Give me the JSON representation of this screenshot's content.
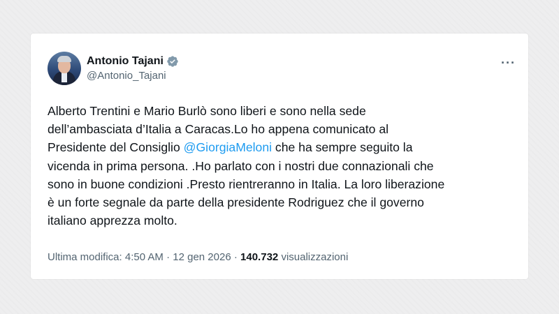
{
  "colors": {
    "background": "#eeeeef",
    "card": "#ffffff",
    "text": "#0f1419",
    "muted": "#536471",
    "link": "#1d9bf0",
    "verified_badge": "#829aab"
  },
  "author": {
    "display_name": "Antonio Tajani",
    "handle": "@Antonio_Tajani",
    "verified_icon": "verified-badge-icon",
    "avatar_icon": "profile-avatar"
  },
  "more_menu": {
    "label": "···",
    "icon": "more-options-icon"
  },
  "tweet": {
    "text_part1": "Alberto Trentini e Mario Burlò sono liberi e sono nella sede\ndell’ambasciata d’Italia a Caracas.Lo ho appena comunicato al\nPresidente del Consiglio ",
    "mention": "@GiorgiaMeloni",
    "text_part2": " che ha sempre seguito la\nvicenda in prima persona. .Ho parlato con i nostri due connazionali che\nsono in buone condizioni .Presto rientreranno in Italia. La loro liberazione\nè un forte segnale da parte della presidente Rodriguez che il governo\nitaliano apprezza molto."
  },
  "meta": {
    "edited_label": "Ultima modifica:",
    "time": "4:50 AM",
    "separator1": "·",
    "date": "12 gen 2026",
    "separator2": "·",
    "views_count": "140.732",
    "views_label": "visualizzazioni"
  }
}
